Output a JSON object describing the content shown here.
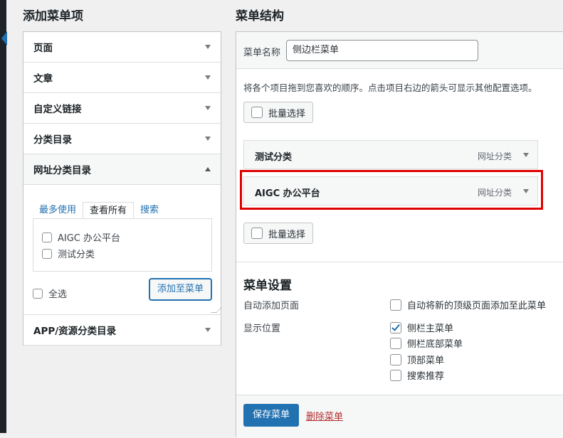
{
  "left": {
    "heading": "添加菜单项",
    "sections": [
      {
        "label": "页面"
      },
      {
        "label": "文章"
      },
      {
        "label": "自定义链接"
      },
      {
        "label": "分类目录"
      },
      {
        "label": "网址分类目录"
      }
    ],
    "tabs": [
      "最多使用",
      "查看所有",
      "搜索"
    ],
    "items": [
      "AIGC 办公平台",
      "测试分类"
    ],
    "select_all": "全选",
    "add_button": "添加至菜单",
    "last_section": "APP/资源分类目录"
  },
  "right": {
    "heading": "菜单结构",
    "name_label": "菜单名称",
    "name_value": "侧边栏菜单",
    "instructions": "将各个项目拖到您喜欢的顺序。点击项目右边的箭头可显示其他配置选项。",
    "bulk_select": "批量选择",
    "menu_items": [
      {
        "title": "测试分类",
        "type": "网址分类"
      },
      {
        "title": "AIGC 办公平台",
        "type": "网址分类"
      }
    ],
    "settings_title": "菜单设置",
    "auto_add_label": "自动添加页面",
    "auto_add_option": "自动将新的顶级页面添加至此菜单",
    "location_label": "显示位置",
    "locations": [
      {
        "label": "侧栏主菜单",
        "checked": true
      },
      {
        "label": "侧栏底部菜单",
        "checked": false
      },
      {
        "label": "顶部菜单",
        "checked": false
      },
      {
        "label": "搜索推荐",
        "checked": false
      }
    ],
    "save_button": "保存菜单",
    "delete_link": "删除菜单"
  },
  "colors": {
    "accent": "#2271b1",
    "highlight_box": "#e00000",
    "delete": "#b32d2e",
    "sidebar": "#1d2327"
  }
}
